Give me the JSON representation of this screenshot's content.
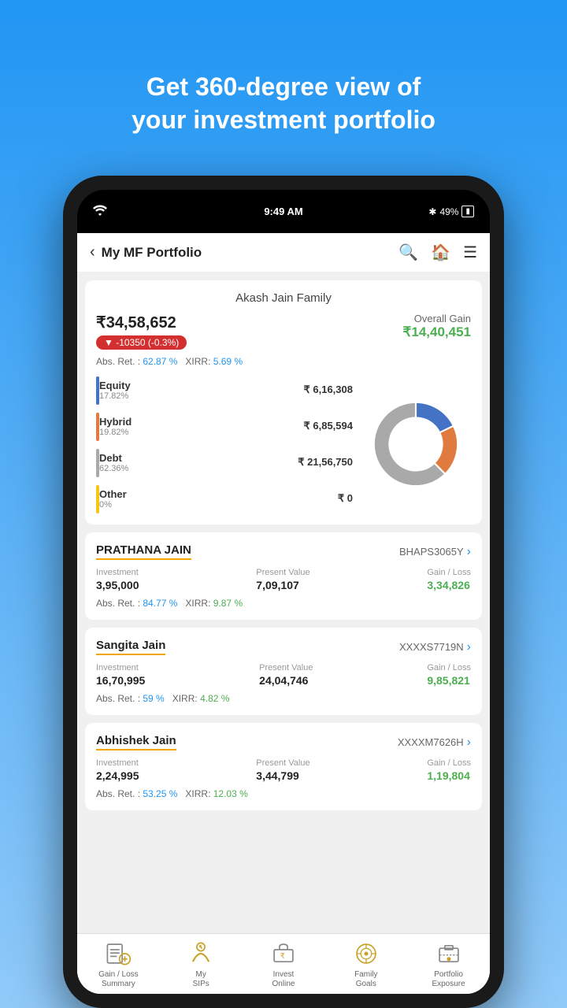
{
  "hero": {
    "line1": "Get 360-degree view of",
    "line2": "your investment portfolio"
  },
  "statusBar": {
    "time": "9:49 AM",
    "battery": "49%"
  },
  "header": {
    "back": "‹",
    "title": "My MF Portfolio"
  },
  "portfolio": {
    "familyName": "Akash Jain Family",
    "totalAmount": "₹34,58,652",
    "change": "▼ -10350  (-0.3%)",
    "absReturn": "62.87 %",
    "xirr": "5.69 %",
    "overallGainLabel": "Overall Gain",
    "overallGainAmount": "₹14,40,451"
  },
  "legend": [
    {
      "name": "Equity",
      "pct": "17.82%",
      "value": "₹ 6,16,308",
      "color": "#4472C4"
    },
    {
      "name": "Hybrid",
      "pct": "19.82%",
      "value": "₹ 6,85,594",
      "color": "#E07B3F"
    },
    {
      "name": "Debt",
      "pct": "62.36%",
      "value": "₹ 21,56,750",
      "color": "#A9A9A9"
    },
    {
      "name": "Other",
      "pct": "0%",
      "value": "₹ 0",
      "color": "#F5C518"
    }
  ],
  "donut": {
    "segments": [
      {
        "color": "#4472C4",
        "pct": 17.82
      },
      {
        "color": "#E07B3F",
        "pct": 19.82
      },
      {
        "color": "#A9A9A9",
        "pct": 62.36
      },
      {
        "color": "#F5C518",
        "pct": 0
      }
    ]
  },
  "persons": [
    {
      "name": "PRATHANA JAIN",
      "id": "BHAPS3065Y",
      "investment": "3,95,000",
      "presentValue": "7,09,107",
      "gainLoss": "3,34,826",
      "absRet": "84.77 %",
      "xirr": "9.87 %"
    },
    {
      "name": "Sangita Jain",
      "id": "XXXXS7719N",
      "investment": "16,70,995",
      "presentValue": "24,04,746",
      "gainLoss": "9,85,821",
      "absRet": "59 %",
      "xirr": "4.82 %"
    },
    {
      "name": "Abhishek Jain",
      "id": "XXXXM7626H",
      "investment": "2,24,995",
      "presentValue": "3,44,799",
      "gainLoss": "1,19,804",
      "absRet": "53.25 %",
      "xirr": "12.03 %"
    }
  ],
  "bottomNav": [
    {
      "label": "Gain / Loss\nSummary",
      "icon": "gain-loss"
    },
    {
      "label": "My\nSIPs",
      "icon": "my-sips"
    },
    {
      "label": "Invest\nOnline",
      "icon": "invest-online"
    },
    {
      "label": "Family\nGoals",
      "icon": "family-goals"
    },
    {
      "label": "Portfolio\nExposure",
      "icon": "portfolio-exposure"
    }
  ]
}
